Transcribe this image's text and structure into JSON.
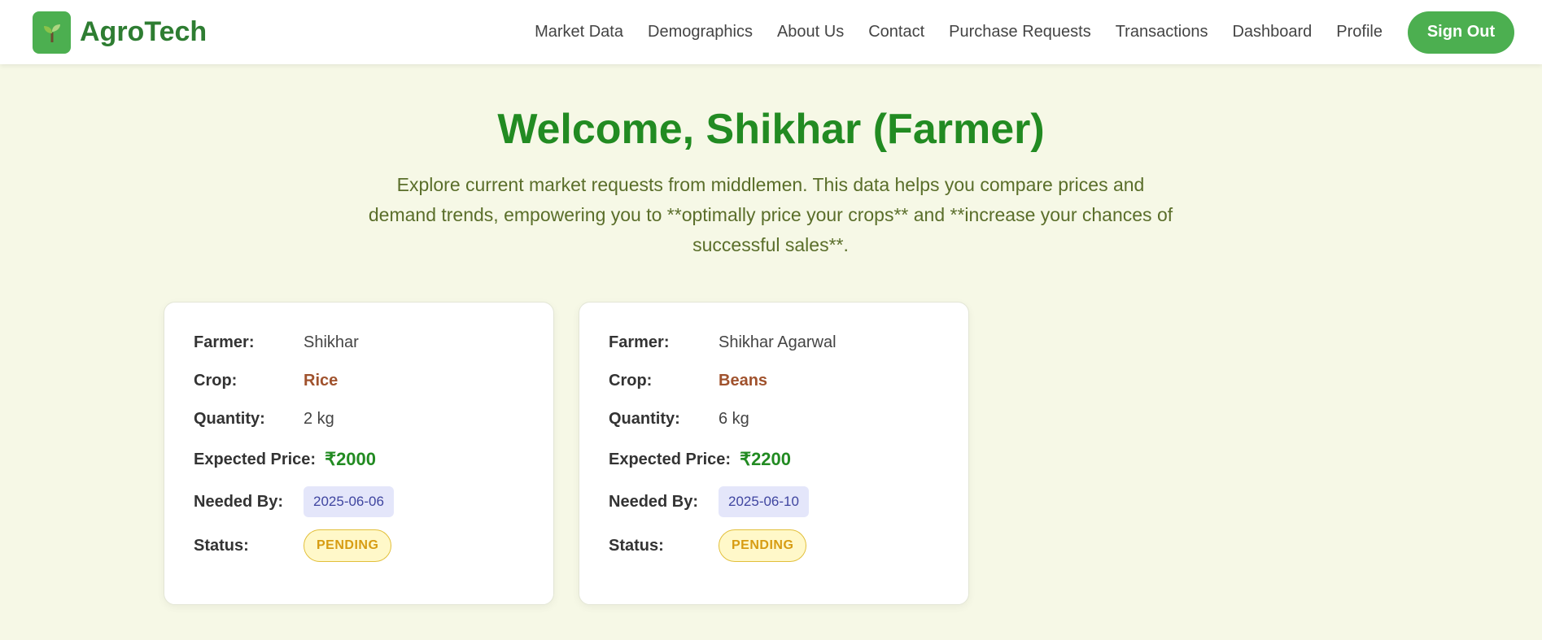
{
  "brand": {
    "name": "AgroTech",
    "logo_icon": "seedling-icon",
    "accent": "#4caf50"
  },
  "nav": {
    "links": [
      "Market Data",
      "Demographics",
      "About Us",
      "Contact",
      "Purchase Requests",
      "Transactions",
      "Dashboard",
      "Profile"
    ],
    "signout_label": "Sign Out"
  },
  "page": {
    "title": "Welcome, Shikhar (Farmer)",
    "intro": "Explore current market requests from middlemen. This data helps you compare prices and demand trends, empowering you to **optimally price your crops** and **increase your chances of successful sales**."
  },
  "labels": {
    "farmer": "Farmer:",
    "crop": "Crop:",
    "quantity": "Quantity:",
    "expected_price": "Expected Price:",
    "needed_by": "Needed By:",
    "status": "Status:"
  },
  "requests": [
    {
      "farmer": "Shikhar",
      "crop": "Rice",
      "quantity": "2 kg",
      "expected_price": "₹2000",
      "needed_by": "2025-06-06",
      "status": "PENDING"
    },
    {
      "farmer": "Shikhar Agarwal",
      "crop": "Beans",
      "quantity": "6 kg",
      "expected_price": "₹2200",
      "needed_by": "2025-06-10",
      "status": "PENDING"
    }
  ],
  "colors": {
    "title": "#228b22",
    "crop": "#a0522d",
    "price": "#228b22",
    "pending": "#d79c12",
    "background": "#f6f8e6"
  }
}
